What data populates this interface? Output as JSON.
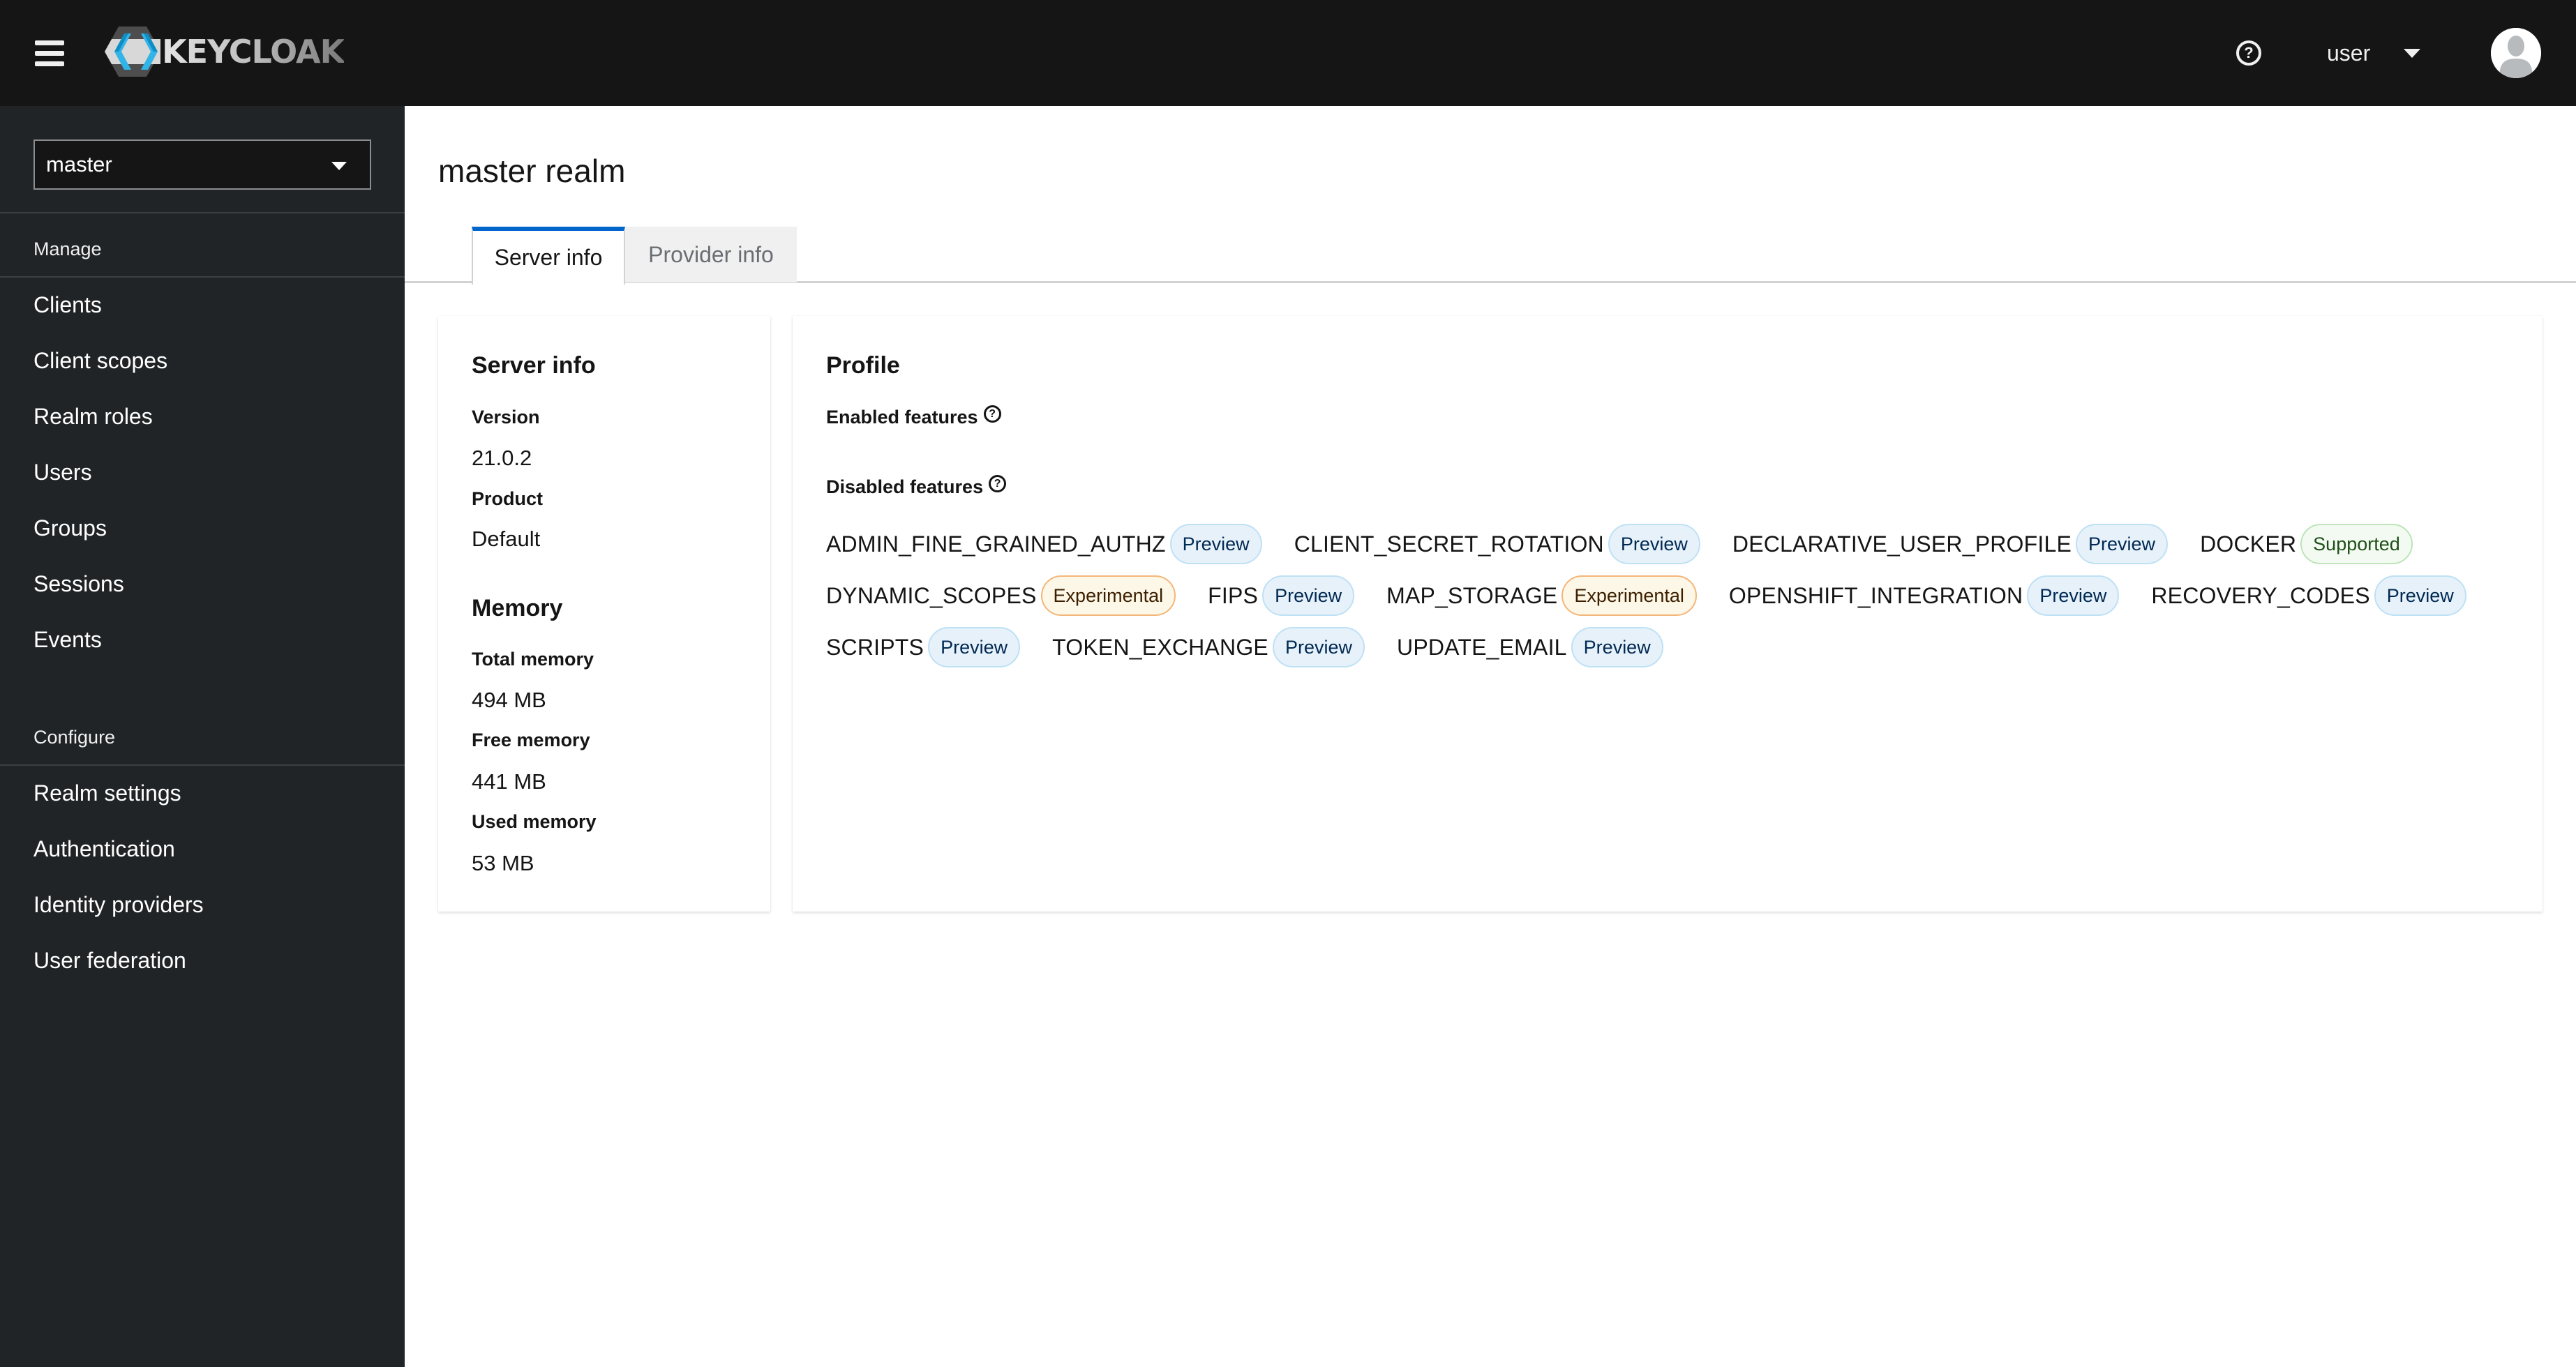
{
  "header": {
    "brand": "KEYCLOAK",
    "help_icon": "question-circle-icon",
    "username": "user"
  },
  "sidebar": {
    "realm_selector": {
      "value": "master"
    },
    "sections": [
      {
        "title": "Manage",
        "items": [
          {
            "label": "Clients"
          },
          {
            "label": "Client scopes"
          },
          {
            "label": "Realm roles"
          },
          {
            "label": "Users"
          },
          {
            "label": "Groups"
          },
          {
            "label": "Sessions"
          },
          {
            "label": "Events"
          }
        ]
      },
      {
        "title": "Configure",
        "items": [
          {
            "label": "Realm settings"
          },
          {
            "label": "Authentication"
          },
          {
            "label": "Identity providers"
          },
          {
            "label": "User federation"
          }
        ]
      }
    ]
  },
  "main": {
    "title": "master realm",
    "tabs": [
      {
        "label": "Server info",
        "active": true
      },
      {
        "label": "Provider info",
        "active": false
      }
    ],
    "server_info": {
      "title": "Server info",
      "version_label": "Version",
      "version": "21.0.2",
      "product_label": "Product",
      "product": "Default",
      "memory_title": "Memory",
      "total_memory_label": "Total memory",
      "total_memory": "494 MB",
      "free_memory_label": "Free memory",
      "free_memory": "441 MB",
      "used_memory_label": "Used memory",
      "used_memory": "53 MB"
    },
    "profile": {
      "title": "Profile",
      "enabled_label": "Enabled features",
      "disabled_label": "Disabled features",
      "help_glyph": "?",
      "disabled_features": [
        {
          "name": "ADMIN_FINE_GRAINED_AUTHZ",
          "badge": "Preview",
          "type": "preview"
        },
        {
          "name": "CLIENT_SECRET_ROTATION",
          "badge": "Preview",
          "type": "preview"
        },
        {
          "name": "DECLARATIVE_USER_PROFILE",
          "badge": "Preview",
          "type": "preview"
        },
        {
          "name": "DOCKER",
          "badge": "Supported",
          "type": "supported"
        },
        {
          "name": "DYNAMIC_SCOPES",
          "badge": "Experimental",
          "type": "experimental"
        },
        {
          "name": "FIPS",
          "badge": "Preview",
          "type": "preview"
        },
        {
          "name": "MAP_STORAGE",
          "badge": "Experimental",
          "type": "experimental"
        },
        {
          "name": "OPENSHIFT_INTEGRATION",
          "badge": "Preview",
          "type": "preview"
        },
        {
          "name": "RECOVERY_CODES",
          "badge": "Preview",
          "type": "preview"
        },
        {
          "name": "SCRIPTS",
          "badge": "Preview",
          "type": "preview"
        },
        {
          "name": "TOKEN_EXCHANGE",
          "badge": "Preview",
          "type": "preview"
        },
        {
          "name": "UPDATE_EMAIL",
          "badge": "Preview",
          "type": "preview"
        }
      ]
    }
  },
  "colors": {
    "masthead_bg": "#151515",
    "sidebar_bg": "#212427",
    "tab_accent": "#0066cc",
    "preview_badge_bg": "#e7f1fa",
    "experimental_badge_bg": "#fdf7e7",
    "supported_badge_bg": "#f3faf2"
  }
}
